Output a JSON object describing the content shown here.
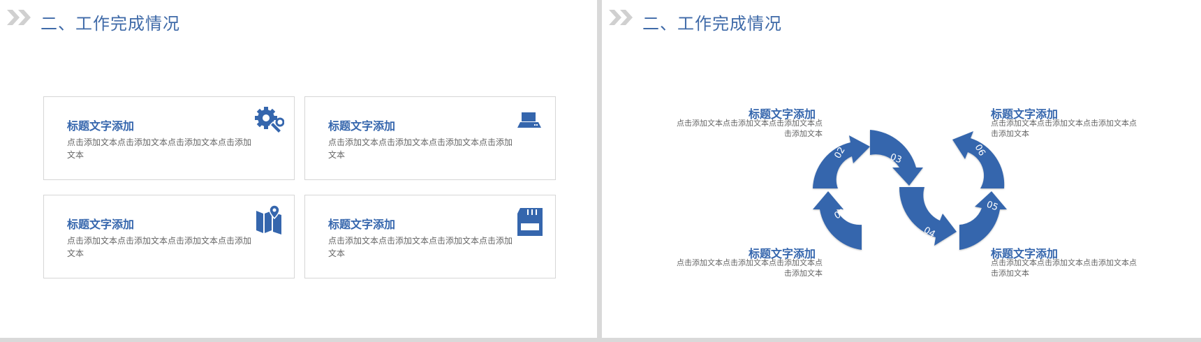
{
  "left": {
    "title": "二、工作完成情况",
    "cards": [
      {
        "title": "标题文字添加",
        "body": "点击添加文本点击添加文本点击添加文本点击添加文本",
        "icon": "gear-wrench-icon"
      },
      {
        "title": "标题文字添加",
        "body": "点击添加文本点击添加文本点击添加文本点击添加文本",
        "icon": "laptop-icon"
      },
      {
        "title": "标题文字添加",
        "body": "点击添加文本点击添加文本点击添加文本点击添加文本",
        "icon": "map-pin-icon"
      },
      {
        "title": "标题文字添加",
        "body": "点击添加文本点击添加文本点击添加文本点击添加文本",
        "icon": "sd-card-icon"
      }
    ]
  },
  "right": {
    "title": "二、工作完成情况",
    "captions": [
      {
        "title": "标题文字添加",
        "body": "点击添加文本点击添加文本点击添加文本点击添加文本"
      },
      {
        "title": "标题文字添加",
        "body": "点击添加文本点击添加文本点击添加文本点击添加文本"
      },
      {
        "title": "标题文字添加",
        "body": "点击添加文本点击添加文本点击添加文本点击添加文本"
      },
      {
        "title": "标题文字添加",
        "body": "点击添加文本点击添加文本点击添加文本点击添加文本"
      }
    ],
    "steps": [
      "01",
      "02",
      "03",
      "04",
      "05",
      "06"
    ]
  },
  "colors": {
    "accent": "#3566ad",
    "title": "#3f6aa8",
    "chevron": "#d0d0d0"
  }
}
